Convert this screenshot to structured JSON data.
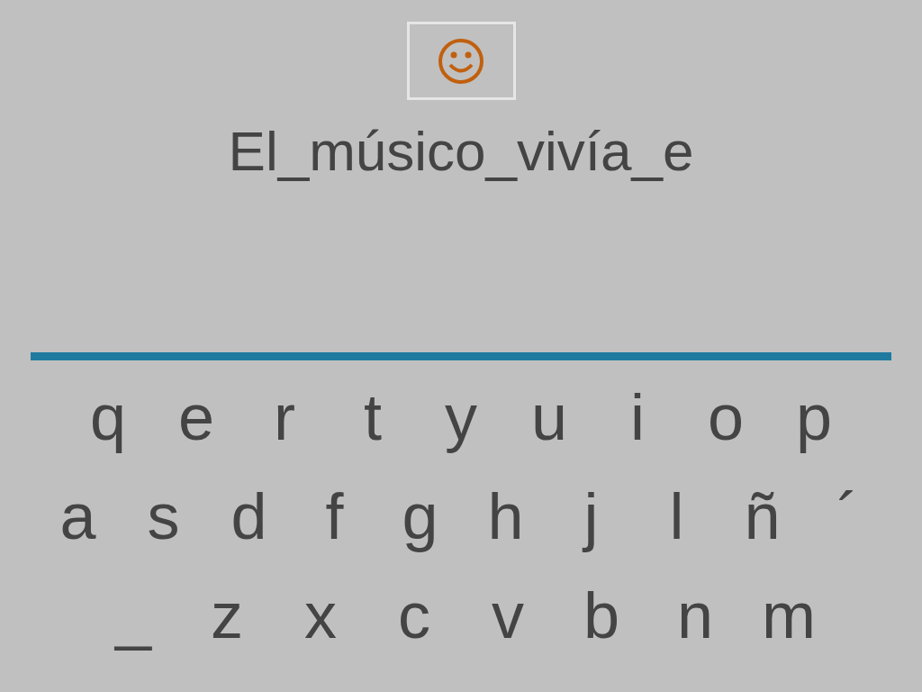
{
  "feedback": {
    "kind": "smile"
  },
  "sentence": "El_músico_vivía_e",
  "keyboard": [
    [
      "q",
      "e",
      "r",
      "t",
      "y",
      "u",
      "i",
      "o",
      "p"
    ],
    [
      "a",
      "s",
      "d",
      "f",
      "g",
      "h",
      "j",
      "l",
      "ñ",
      "´"
    ],
    [
      "_",
      "z",
      "x",
      "c",
      "v",
      "b",
      "n",
      "m"
    ]
  ]
}
